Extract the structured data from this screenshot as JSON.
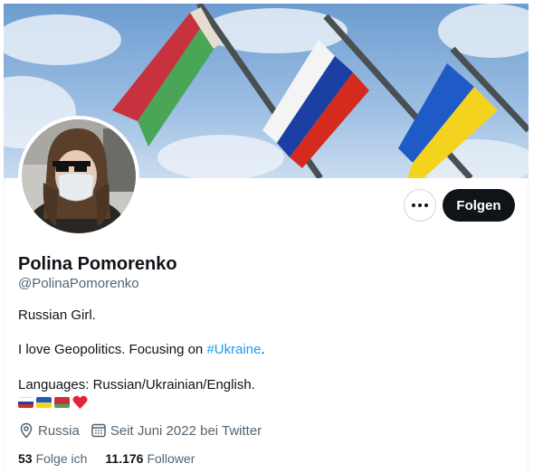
{
  "profile": {
    "display_name": "Polina Pomorenko",
    "handle": "@PolinaPomorenko",
    "bio_line1": "Russian Girl.",
    "bio_line2_prefix": "I love Geopolitics. Focusing on ",
    "bio_hashtag": "#Ukraine",
    "bio_line2_suffix": ".",
    "bio_line3": "Languages: Russian/Ukrainian/English.",
    "bio_emojis": [
      "russia-flag-emoji",
      "ukraine-flag-emoji",
      "belarus-flag-emoji",
      "red-heart-emoji"
    ],
    "location": "Russia",
    "joined": "Seit Juni 2022 bei Twitter",
    "following_count": "53",
    "following_label": "Folge ich",
    "followers_count": "11.176",
    "followers_label": "Follower"
  },
  "actions": {
    "follow_label": "Folgen",
    "more_icon": "more-horizontal-icon"
  },
  "banner": {
    "flags": [
      "Belarus",
      "Russia",
      "Ukraine"
    ]
  },
  "colors": {
    "text_primary": "#0f1419",
    "text_secondary": "#536471",
    "link": "#1d9bf0",
    "follow_button_bg": "#0f1419"
  }
}
